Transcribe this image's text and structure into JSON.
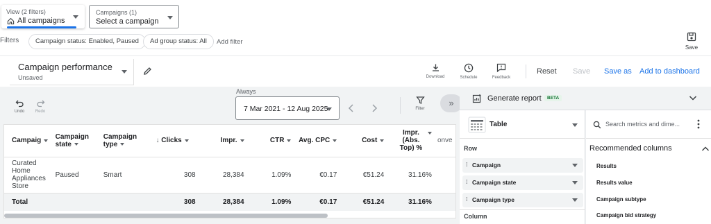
{
  "view_selector": {
    "label": "View (2 filters)",
    "value": "All campaigns"
  },
  "campaign_selector": {
    "label": "Campaigns (1)",
    "value": "Select a campaign"
  },
  "filters": {
    "label": "Filters",
    "chips": [
      "Campaign status: Enabled, Paused",
      "Ad group status: All"
    ],
    "add_filter": "Add filter"
  },
  "save_top_label": "Save",
  "report": {
    "title": "Campaign performance",
    "subtitle": "Unsaved"
  },
  "toolbar": {
    "download": "Download",
    "schedule": "Schedule",
    "feedback": "Feedback",
    "reset": "Reset",
    "save": "Save",
    "save_as": "Save as",
    "add_to_dashboard": "Add to dashboard",
    "undo": "Undo",
    "redo": "Redo",
    "filter": "Filter"
  },
  "date_range": {
    "label": "Always",
    "value": "7 Mar 2021 - 12 Aug 2025"
  },
  "table": {
    "columns": [
      "Campaig",
      "Campaign state",
      "Campaign type",
      "Clicks",
      "Impr.",
      "CTR",
      "Avg. CPC",
      "Cost",
      "Impr. (Abs. Top) %",
      "onve"
    ],
    "rows": [
      [
        "Curated Home Appliances Store",
        "Paused",
        "Smart",
        "308",
        "28,384",
        "1.09%",
        "€0.17",
        "€51.24",
        "31.16%"
      ]
    ],
    "total": [
      "Total",
      "",
      "",
      "308",
      "28,384",
      "1.09%",
      "€0.17",
      "€51.24",
      "31.16%"
    ]
  },
  "panel": {
    "title": "Generate report",
    "badge": "BETA",
    "chart_type": "Table",
    "row_header": "Row",
    "row_items": [
      "Campaign",
      "Campaign state",
      "Campaign type"
    ],
    "column_header": "Column",
    "search_placeholder": "Search metrics and dime...",
    "recommended_header": "Recommended columns",
    "recommended_items": [
      "Results",
      "Results value",
      "Campaign subtype",
      "Campaign bid strategy"
    ]
  },
  "colors": {
    "accent": "#1a73e8",
    "beta_text": "#137333",
    "beta_bg": "#e6f4ea"
  }
}
